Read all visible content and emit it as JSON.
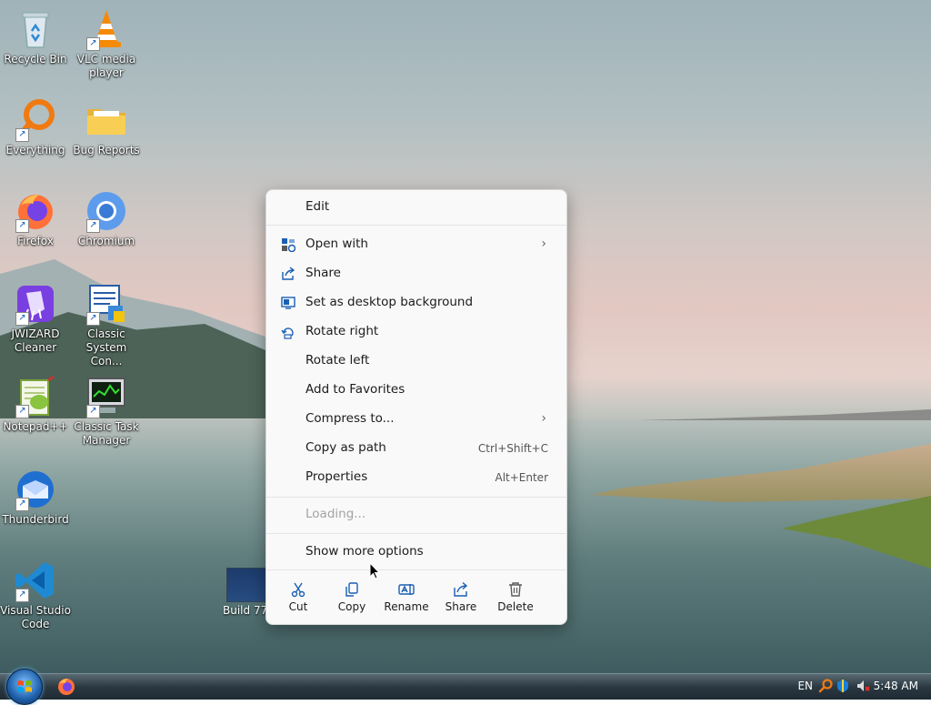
{
  "desktop": {
    "icons": [
      {
        "label": "Recycle Bin",
        "icon": "recycle-bin-icon"
      },
      {
        "label": "VLC media player",
        "icon": "vlc-icon"
      },
      {
        "label": "Everything",
        "icon": "everything-search-icon"
      },
      {
        "label": "Bug Reports",
        "icon": "folder-icon"
      },
      {
        "label": "Firefox",
        "icon": "firefox-icon"
      },
      {
        "label": "Chromium",
        "icon": "chromium-icon"
      },
      {
        "label": "JWIZARD Cleaner",
        "icon": "cleaner-icon"
      },
      {
        "label": "Classic System Con...",
        "icon": "system-config-icon"
      },
      {
        "label": "Notepad++",
        "icon": "notepadpp-icon"
      },
      {
        "label": "Classic Task Manager",
        "icon": "task-manager-icon"
      },
      {
        "label": "Thunderbird",
        "icon": "thunderbird-icon"
      },
      {
        "label": "Visual Studio Code",
        "icon": "vscode-icon"
      }
    ],
    "selected_file_label": "Build 776"
  },
  "context_menu": {
    "edit": "Edit",
    "open_with": "Open with",
    "share": "Share",
    "set_background": "Set as desktop background",
    "rotate_right": "Rotate right",
    "rotate_left": "Rotate left",
    "add_favorites": "Add to Favorites",
    "compress": "Compress to...",
    "copy_path": "Copy as path",
    "copy_path_shortcut": "Ctrl+Shift+C",
    "properties": "Properties",
    "properties_shortcut": "Alt+Enter",
    "loading": "Loading...",
    "show_more": "Show more options",
    "bar": {
      "cut": "Cut",
      "copy": "Copy",
      "rename": "Rename",
      "share": "Share",
      "delete": "Delete"
    }
  },
  "taskbar": {
    "language": "EN",
    "clock": "5:48 AM"
  },
  "colors": {
    "accent": "#1a5fb4",
    "menu_bg": "#f9f9f9"
  }
}
